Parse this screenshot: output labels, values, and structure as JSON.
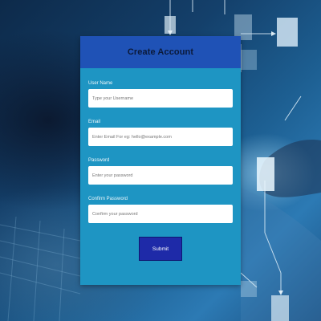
{
  "form": {
    "title": "Create Account",
    "fields": [
      {
        "label": "User Name",
        "placeholder": "Type your Username",
        "type": "text"
      },
      {
        "label": "Email",
        "placeholder": "Enter Email For eg: hello@example.com",
        "type": "email"
      },
      {
        "label": "Password",
        "placeholder": "Enter your password",
        "type": "password"
      },
      {
        "label": "Confirm Password",
        "placeholder": "Confirm your password",
        "type": "password"
      }
    ],
    "submit_label": "Submit"
  },
  "colors": {
    "card_body": "#1e95c3",
    "card_header": "#1f52b6",
    "submit_button": "#1e2aa8"
  }
}
